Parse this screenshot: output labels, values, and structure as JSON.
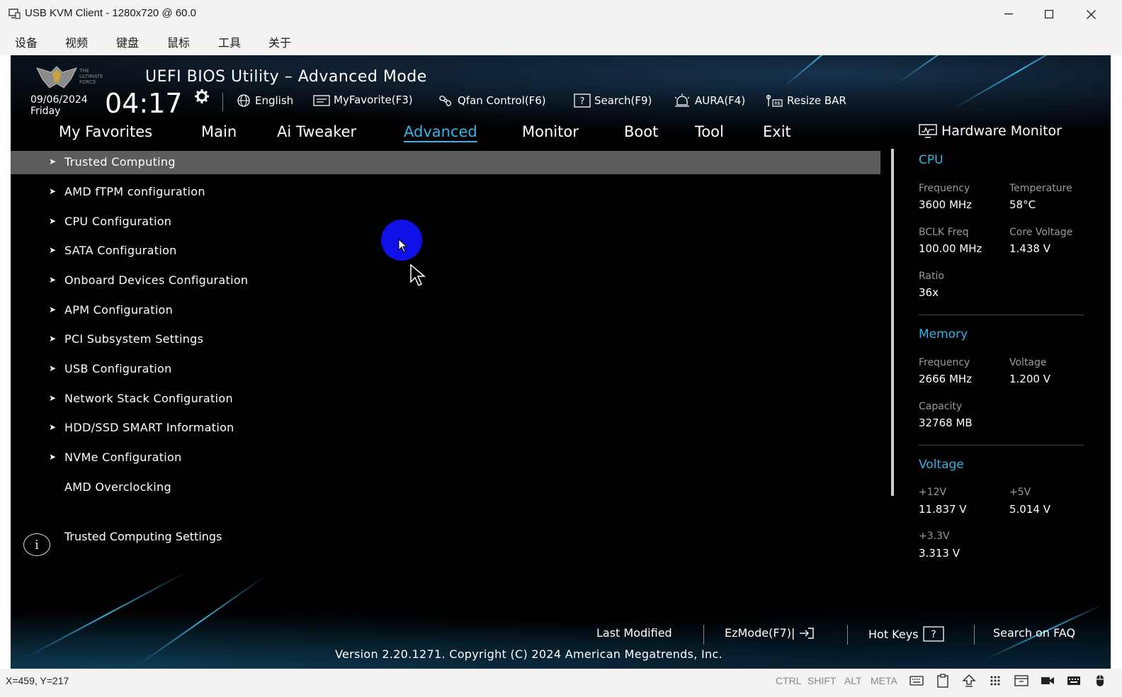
{
  "window": {
    "title": "USB KVM Client - 1280x720 @ 60.0",
    "icons": [
      "app-icon",
      "minimize-icon",
      "maximize-icon",
      "close-icon"
    ]
  },
  "menubar": {
    "items": [
      "设备",
      "视频",
      "键盘",
      "鼠标",
      "工具",
      "关于"
    ]
  },
  "bios": {
    "title": "UEFI BIOS Utility – Advanced Mode",
    "date": "09/06/2024",
    "day": "Friday",
    "time": "04:17",
    "toolbar": {
      "language": "English",
      "myfavorite": "MyFavorite(F3)",
      "qfan": "Qfan Control(F6)",
      "search": "Search(F9)",
      "aura": "AURA(F4)",
      "resizebar": "Resize BAR"
    },
    "tabs": [
      "My Favorites",
      "Main",
      "Ai Tweaker",
      "Advanced",
      "Monitor",
      "Boot",
      "Tool",
      "Exit"
    ],
    "active_tab": "Advanced",
    "menu_items": [
      "Trusted Computing",
      "AMD fTPM configuration",
      "CPU Configuration",
      "SATA Configuration",
      "Onboard Devices Configuration",
      "APM Configuration",
      "PCI Subsystem Settings",
      "USB Configuration",
      "Network Stack Configuration",
      "HDD/SSD SMART Information",
      "NVMe Configuration",
      "AMD Overclocking"
    ],
    "selected_index": 0,
    "help_text": "Trusted Computing Settings",
    "hardware_monitor": {
      "title": "Hardware Monitor",
      "cpu": {
        "section": "CPU",
        "frequency_label": "Frequency",
        "frequency": "3600 MHz",
        "temperature_label": "Temperature",
        "temperature": "58°C",
        "bclk_label": "BCLK Freq",
        "bclk": "100.00 MHz",
        "core_voltage_label": "Core Voltage",
        "core_voltage": "1.438 V",
        "ratio_label": "Ratio",
        "ratio": "36x"
      },
      "memory": {
        "section": "Memory",
        "frequency_label": "Frequency",
        "frequency": "2666 MHz",
        "voltage_label": "Voltage",
        "voltage": "1.200 V",
        "capacity_label": "Capacity",
        "capacity": "32768 MB"
      },
      "voltage": {
        "section": "Voltage",
        "v12_label": "+12V",
        "v12": "11.837 V",
        "v5_label": "+5V",
        "v5": "5.014 V",
        "v33_label": "+3.3V",
        "v33": "3.313 V"
      }
    },
    "footer": {
      "last_modified": "Last Modified",
      "ezmode": "EzMode(F7)|",
      "hotkeys": "Hot Keys",
      "faq": "Search on FAQ",
      "copyright": "Version 2.20.1271. Copyright (C) 2024 American Megatrends, Inc."
    }
  },
  "statusbar": {
    "coords": "X=459, Y=217",
    "keys": [
      "CTRL",
      "SHIFT",
      "ALT",
      "META"
    ]
  },
  "colors": {
    "accent": "#2fb4e8",
    "bios_bg": "#000000",
    "selected_row": "#5c5c5c",
    "pointer_dot": "#1010e8"
  }
}
